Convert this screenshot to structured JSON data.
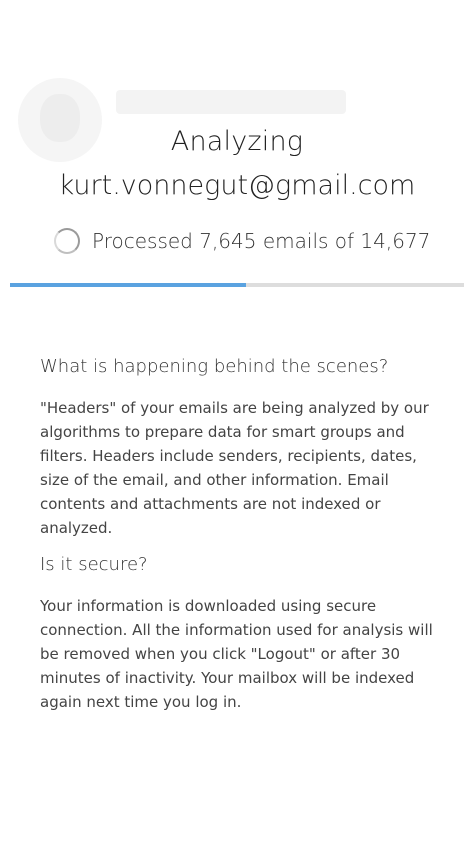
{
  "header": {
    "title": "Analyzing",
    "email": "kurt.vonnegut@gmail.com"
  },
  "status": {
    "text": "Processed 7,645 emails of 14,677",
    "processed": 7645,
    "total": 14677
  },
  "progress": {
    "fraction": 0.52,
    "fill_color": "#5aa2e0",
    "track_color": "#dddddd"
  },
  "info": {
    "q1": "What is happening behind the scenes?",
    "a1": "\"Headers\" of your emails are being analyzed by our algorithms to prepare data for smart groups and filters. Headers include senders, recipients, dates, size of the email, and other information. Email contents and attachments are not indexed or analyzed.",
    "q2": "Is it secure?",
    "a2": "Your information is downloaded using secure connection. All the information used for analysis will be removed when you click \"Logout\" or after 30 minutes of inactivity. Your mailbox will be indexed again next time you log in."
  },
  "icons": {
    "spinner": "loading-spinner-icon"
  }
}
